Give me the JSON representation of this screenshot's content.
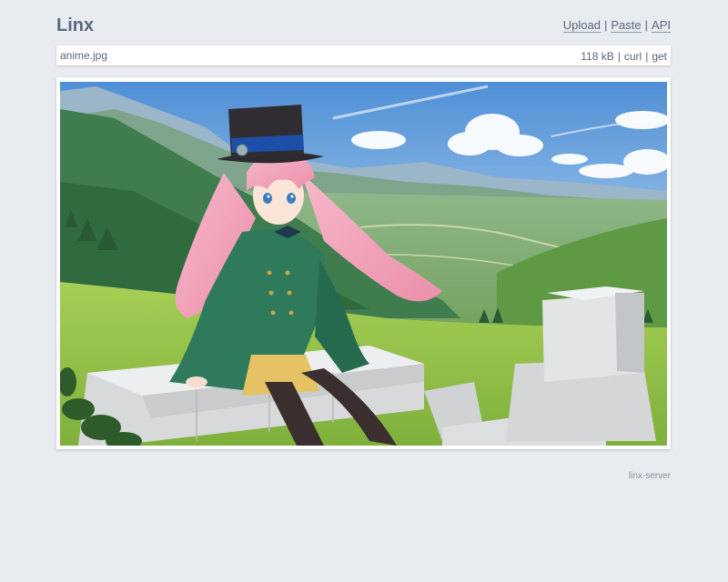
{
  "header": {
    "logo": "Linx",
    "nav": {
      "upload": "Upload",
      "paste": "Paste",
      "api": "API",
      "separator": "|"
    }
  },
  "file": {
    "name": "anime.jpg",
    "size": "118 kB",
    "curl": "curl",
    "get": "get",
    "separator": "|"
  },
  "image": {
    "subject": "anime illustration: pink-haired girl in green coat and black top hat sitting on a stone wall overlooking green mountain valley"
  },
  "footer": {
    "text": "linx-server"
  },
  "colors": {
    "background": "#e8ebef",
    "text": "#5a6880",
    "panel": "#ffffff"
  }
}
